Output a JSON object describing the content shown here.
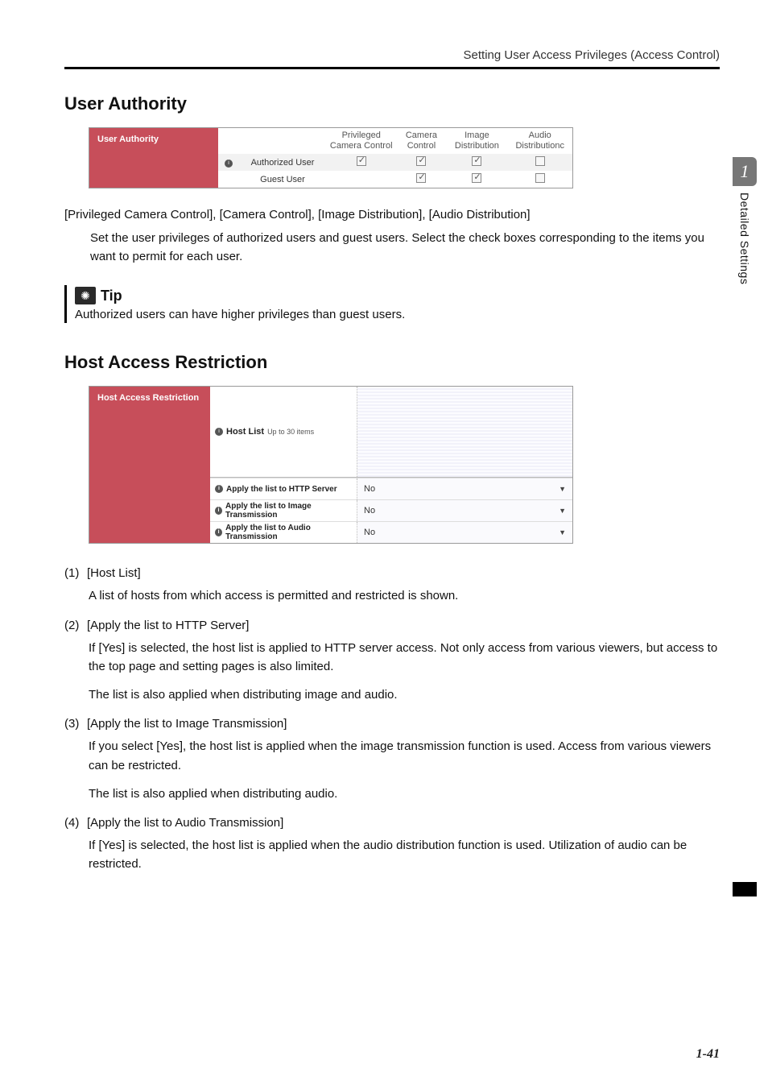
{
  "header": {
    "running": "Setting User Access Privileges (Access Control)"
  },
  "side": {
    "chapter_num": "1",
    "chapter_label": "Detailed Settings"
  },
  "pageNumber": "1-41",
  "section1": {
    "title": "User Authority",
    "panel": {
      "sidebar": "User Authority",
      "cols": {
        "c1": "Privileged Camera Control",
        "c2": "Camera Control",
        "c3": "Image Distribution",
        "c4": "Audio Distributionc"
      },
      "rows": {
        "r1_label": "Authorized User",
        "r2_label": "Guest User"
      }
    },
    "line_bracketed": "[Privileged Camera Control], [Camera Control], [Image Distribution], [Audio Distribution]",
    "para": "Set the user privileges of authorized users and guest users. Select the check boxes corresponding to the items you want to permit for each user.",
    "tip_label": "Tip",
    "tip_text": "Authorized users can have higher privileges than guest users."
  },
  "section2": {
    "title": "Host Access Restriction",
    "panel": {
      "sidebar": "Host Access Restriction",
      "hostlist_label": "Host List",
      "hostlist_sub": "Up to 30 items",
      "rows": {
        "r1_label": "Apply the list to HTTP Server",
        "r1_value": "No",
        "r2_label": "Apply the list to Image Transmission",
        "r2_value": "No",
        "r3_label": "Apply the list to Audio Transmission",
        "r3_value": "No"
      }
    },
    "items": {
      "i1_n": "(1)",
      "i1_h": "[Host List]",
      "i1_b": "A list of hosts from which access is permitted and restricted is shown.",
      "i2_n": "(2)",
      "i2_h": "[Apply the list to HTTP Server]",
      "i2_b1": "If [Yes] is selected, the host list is applied to HTTP server access. Not only access from various viewers, but access to the top page and setting pages is also limited.",
      "i2_b2": "The list is also applied when distributing image and audio.",
      "i3_n": "(3)",
      "i3_h": "[Apply the list to Image Transmission]",
      "i3_b1": "If you select [Yes], the host list is applied when the image transmission function is used. Access from various viewers can be restricted.",
      "i3_b2": "The list is also applied when distributing audio.",
      "i4_n": "(4)",
      "i4_h": "[Apply the list to Audio Transmission]",
      "i4_b1": "If [Yes] is selected, the host list is applied when the audio distribution function is used. Utilization of audio can be restricted."
    }
  }
}
